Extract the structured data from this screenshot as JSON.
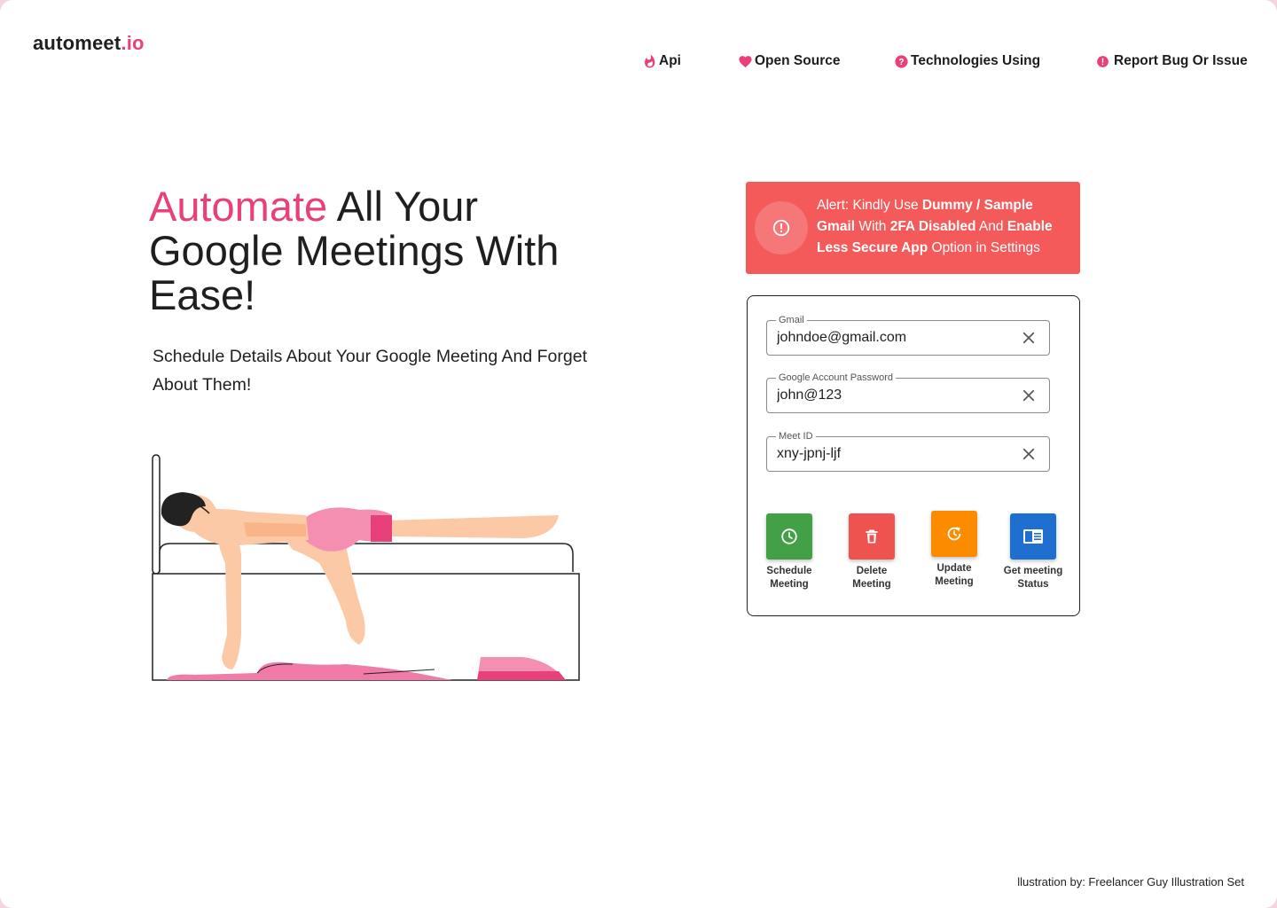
{
  "header": {
    "logo_main": "automeet",
    "logo_tld": ".io",
    "nav": [
      {
        "label": "Api",
        "icon": "fire-icon"
      },
      {
        "label": "Open Source",
        "icon": "heart-icon"
      },
      {
        "label": "Technologies Using",
        "icon": "help-circle-icon"
      },
      {
        "label": "Report Bug Or Issue",
        "icon": "alert-circle-icon"
      }
    ]
  },
  "hero": {
    "title_accent": "Automate",
    "title_rest": " All Your Google Meetings With Ease!",
    "subtitle": "Schedule Details About Your Google Meeting And Forget About Them!"
  },
  "alert": {
    "p1": "Alert: Kindly Use ",
    "b1": "Dummy / Sample Gmail",
    "p2": " With ",
    "b2": "2FA Disabled",
    "p3": " And ",
    "b3": "Enable Less Secure App",
    "p4": " Option in Settings"
  },
  "form": {
    "fields": [
      {
        "label": "Gmail",
        "value": "johndoe@gmail.com"
      },
      {
        "label": "Google Account Password",
        "value": "john@123"
      },
      {
        "label": "Meet ID",
        "value": "xny-jpnj-ljf"
      }
    ],
    "actions": [
      {
        "label": "Schedule Meeting",
        "icon": "clock-icon",
        "color": "#43a047"
      },
      {
        "label": "Delete Meeting",
        "icon": "trash-icon",
        "color": "#ef5350"
      },
      {
        "label": "Update Meeting",
        "icon": "refresh-icon",
        "color": "#fb8c00"
      },
      {
        "label": "Get meeting Status",
        "icon": "status-card-icon",
        "color": "#1e6fd0"
      }
    ]
  },
  "footer": {
    "credit": "llustration by: Freelancer Guy Illustration Set"
  },
  "colors": {
    "brand_pink": "#e8407a",
    "alert_red": "#f55a5a"
  }
}
